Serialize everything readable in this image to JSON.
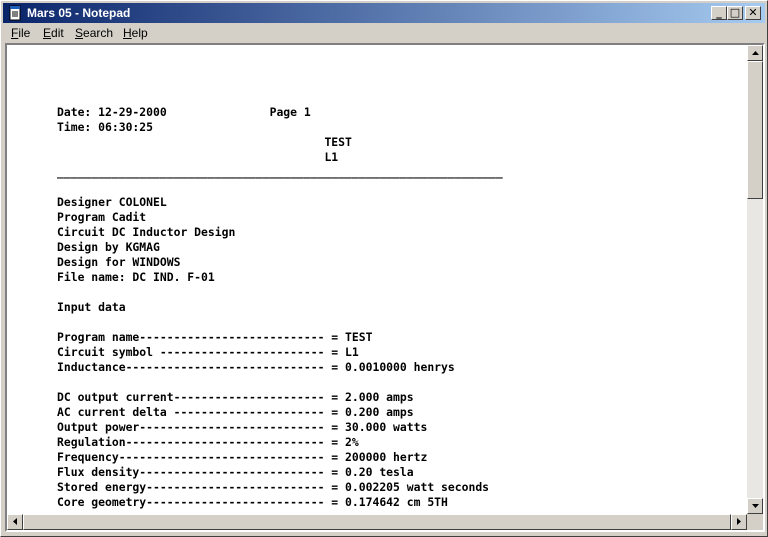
{
  "window": {
    "title": "Mars 05 - Notepad"
  },
  "menu": [
    {
      "label": "File",
      "accel": "F",
      "rest": "ile"
    },
    {
      "label": "Edit",
      "accel": "E",
      "rest": "dit"
    },
    {
      "label": "Search",
      "accel": "S",
      "rest": "earch"
    },
    {
      "label": "Help",
      "accel": "H",
      "rest": "elp"
    }
  ],
  "document": {
    "content": "Date: 12-29-2000               Page 1\nTime: 06:30:25\n                                       TEST\n                                       L1\n_________________________________________________________________\n\nDesigner COLONEL\nProgram Cadit\nCircuit DC Inductor Design\nDesign by KGMAG\nDesign for WINDOWS\nFile name: DC IND. F-01\n\nInput data\n\nProgram name--------------------------- = TEST\nCircuit symbol ------------------------ = L1\nInductance----------------------------- = 0.0010000 henrys\n\nDC output current---------------------- = 2.000 amps\nAC current delta ---------------------- = 0.200 amps\nOutput power--------------------------- = 30.000 watts\nRegulation----------------------------- = 2%\nFrequency------------------------------ = 200000 hertz\nFlux density--------------------------- = 0.20 tesla\nStored energy-------------------------- = 0.002205 watt seconds\nCore geometry-------------------------- = 0.174642 cm 5TH"
  },
  "titlebar_buttons": {
    "minimize": "_",
    "maximize": "□",
    "close": "✕"
  }
}
